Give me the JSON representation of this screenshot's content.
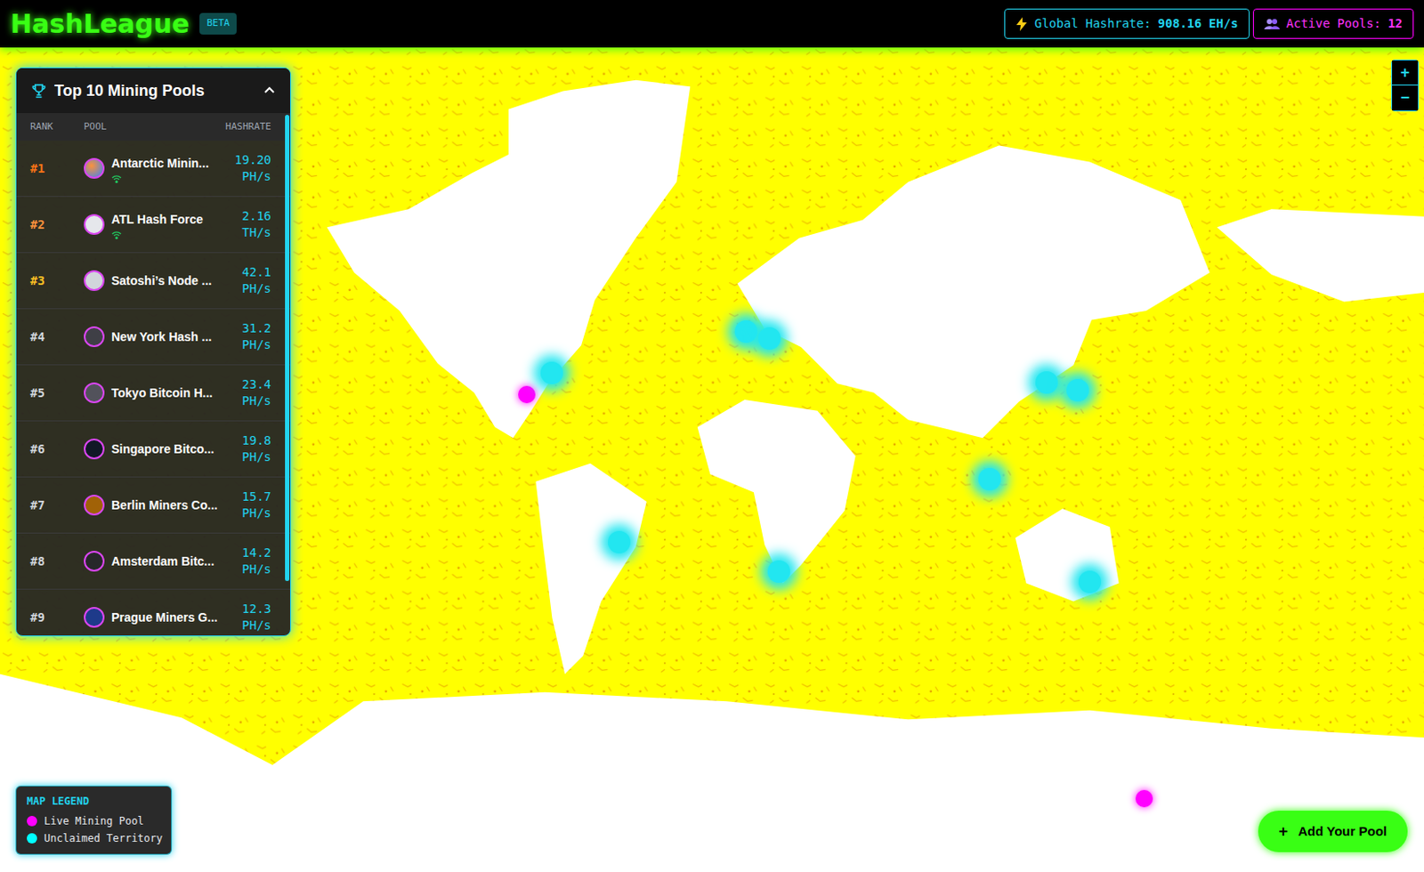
{
  "header": {
    "logo": "HashLeague",
    "badge": "BETA",
    "stats": [
      {
        "label": "Global Hashrate:",
        "value": "908.16 EH/s",
        "kind": "hashrate"
      },
      {
        "label": "Active Pools:",
        "value": "12",
        "kind": "pools"
      }
    ]
  },
  "panel": {
    "title": "Top 10 Mining Pools",
    "expanded": true,
    "columns": [
      "RANK",
      "POOL",
      "HASHRATE"
    ],
    "rows": [
      {
        "rank": "#1",
        "name": "Antarctic Minin...",
        "live": true,
        "hashrate": "19.20",
        "unit": "PH/s"
      },
      {
        "rank": "#2",
        "name": "ATL Hash Force",
        "live": true,
        "hashrate": "2.16",
        "unit": "TH/s"
      },
      {
        "rank": "#3",
        "name": "Satoshi’s Node ...",
        "live": false,
        "hashrate": "42.1",
        "unit": "PH/s"
      },
      {
        "rank": "#4",
        "name": "New York Hash ...",
        "live": false,
        "hashrate": "31.2",
        "unit": "PH/s"
      },
      {
        "rank": "#5",
        "name": "Tokyo Bitcoin H...",
        "live": false,
        "hashrate": "23.4",
        "unit": "PH/s"
      },
      {
        "rank": "#6",
        "name": "Singapore Bitco...",
        "live": false,
        "hashrate": "19.8",
        "unit": "PH/s"
      },
      {
        "rank": "#7",
        "name": "Berlin Miners Co...",
        "live": false,
        "hashrate": "15.7",
        "unit": "PH/s"
      },
      {
        "rank": "#8",
        "name": "Amsterdam Bitc...",
        "live": false,
        "hashrate": "14.2",
        "unit": "PH/s"
      },
      {
        "rank": "#9",
        "name": "Prague Miners G...",
        "live": false,
        "hashrate": "12.3",
        "unit": "PH/s"
      }
    ]
  },
  "legend": {
    "title": "MAP LEGEND",
    "items": [
      {
        "label": "Live Mining Pool",
        "color": "#ff00ff"
      },
      {
        "label": "Unclaimed Territory",
        "color": "#00ffff"
      }
    ]
  },
  "pins": [
    {
      "kind": "live"
    },
    {
      "kind": "live"
    },
    {
      "kind": "unclaimed"
    },
    {
      "kind": "unclaimed"
    },
    {
      "kind": "unclaimed"
    },
    {
      "kind": "unclaimed"
    },
    {
      "kind": "unclaimed"
    },
    {
      "kind": "unclaimed"
    },
    {
      "kind": "unclaimed"
    },
    {
      "kind": "unclaimed"
    },
    {
      "kind": "unclaimed"
    }
  ],
  "zoom": [
    "+",
    "−"
  ],
  "add_button": {
    "icon": "+",
    "label": "Add Your Pool"
  }
}
